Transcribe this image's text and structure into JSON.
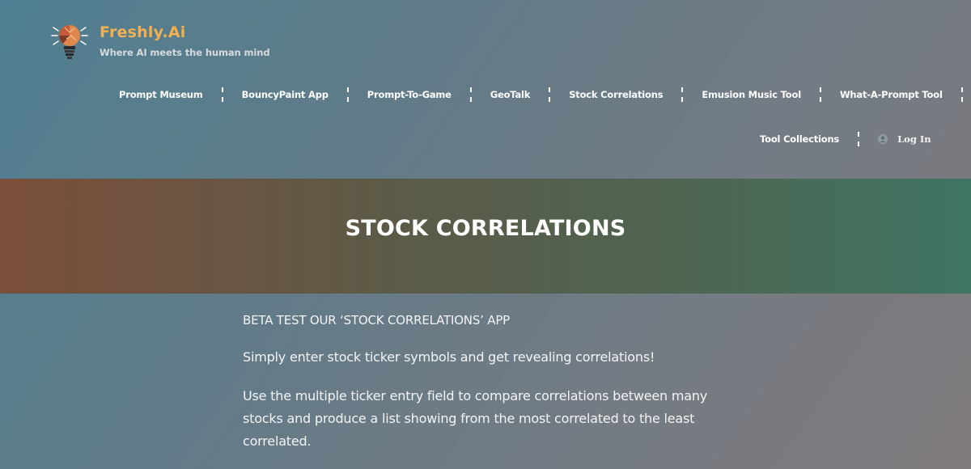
{
  "brand": {
    "name": "Freshly.Ai",
    "tagline": "Where AI meets the human mind"
  },
  "nav": {
    "row1": [
      "Prompt Museum",
      "BouncyPaint App",
      "Prompt-To-Game",
      "GeoTalk",
      "Stock Correlations",
      "Emusion Music Tool",
      "What-A-Prompt Tool"
    ],
    "tool_collections": "Tool Collections",
    "login": "Log In"
  },
  "hero": {
    "title": "STOCK CORRELATIONS"
  },
  "content": {
    "beta_heading": "BETA TEST OUR ‘STOCK CORRELATIONS’ APP",
    "paragraph1": "Simply enter stock ticker symbols and get revealing correlations!",
    "paragraph2": "Use the multiple ticker entry field to compare correlations between many stocks and produce a list showing from the most correlated to the least correlated."
  },
  "icons": {
    "logo": "lightbulb-brain-icon",
    "user": "user-circle-icon",
    "separator": "dashed-separator"
  },
  "colors": {
    "brand": "#f1b153",
    "hero_left": "#7a4e3a",
    "hero_right": "#3f7462"
  }
}
